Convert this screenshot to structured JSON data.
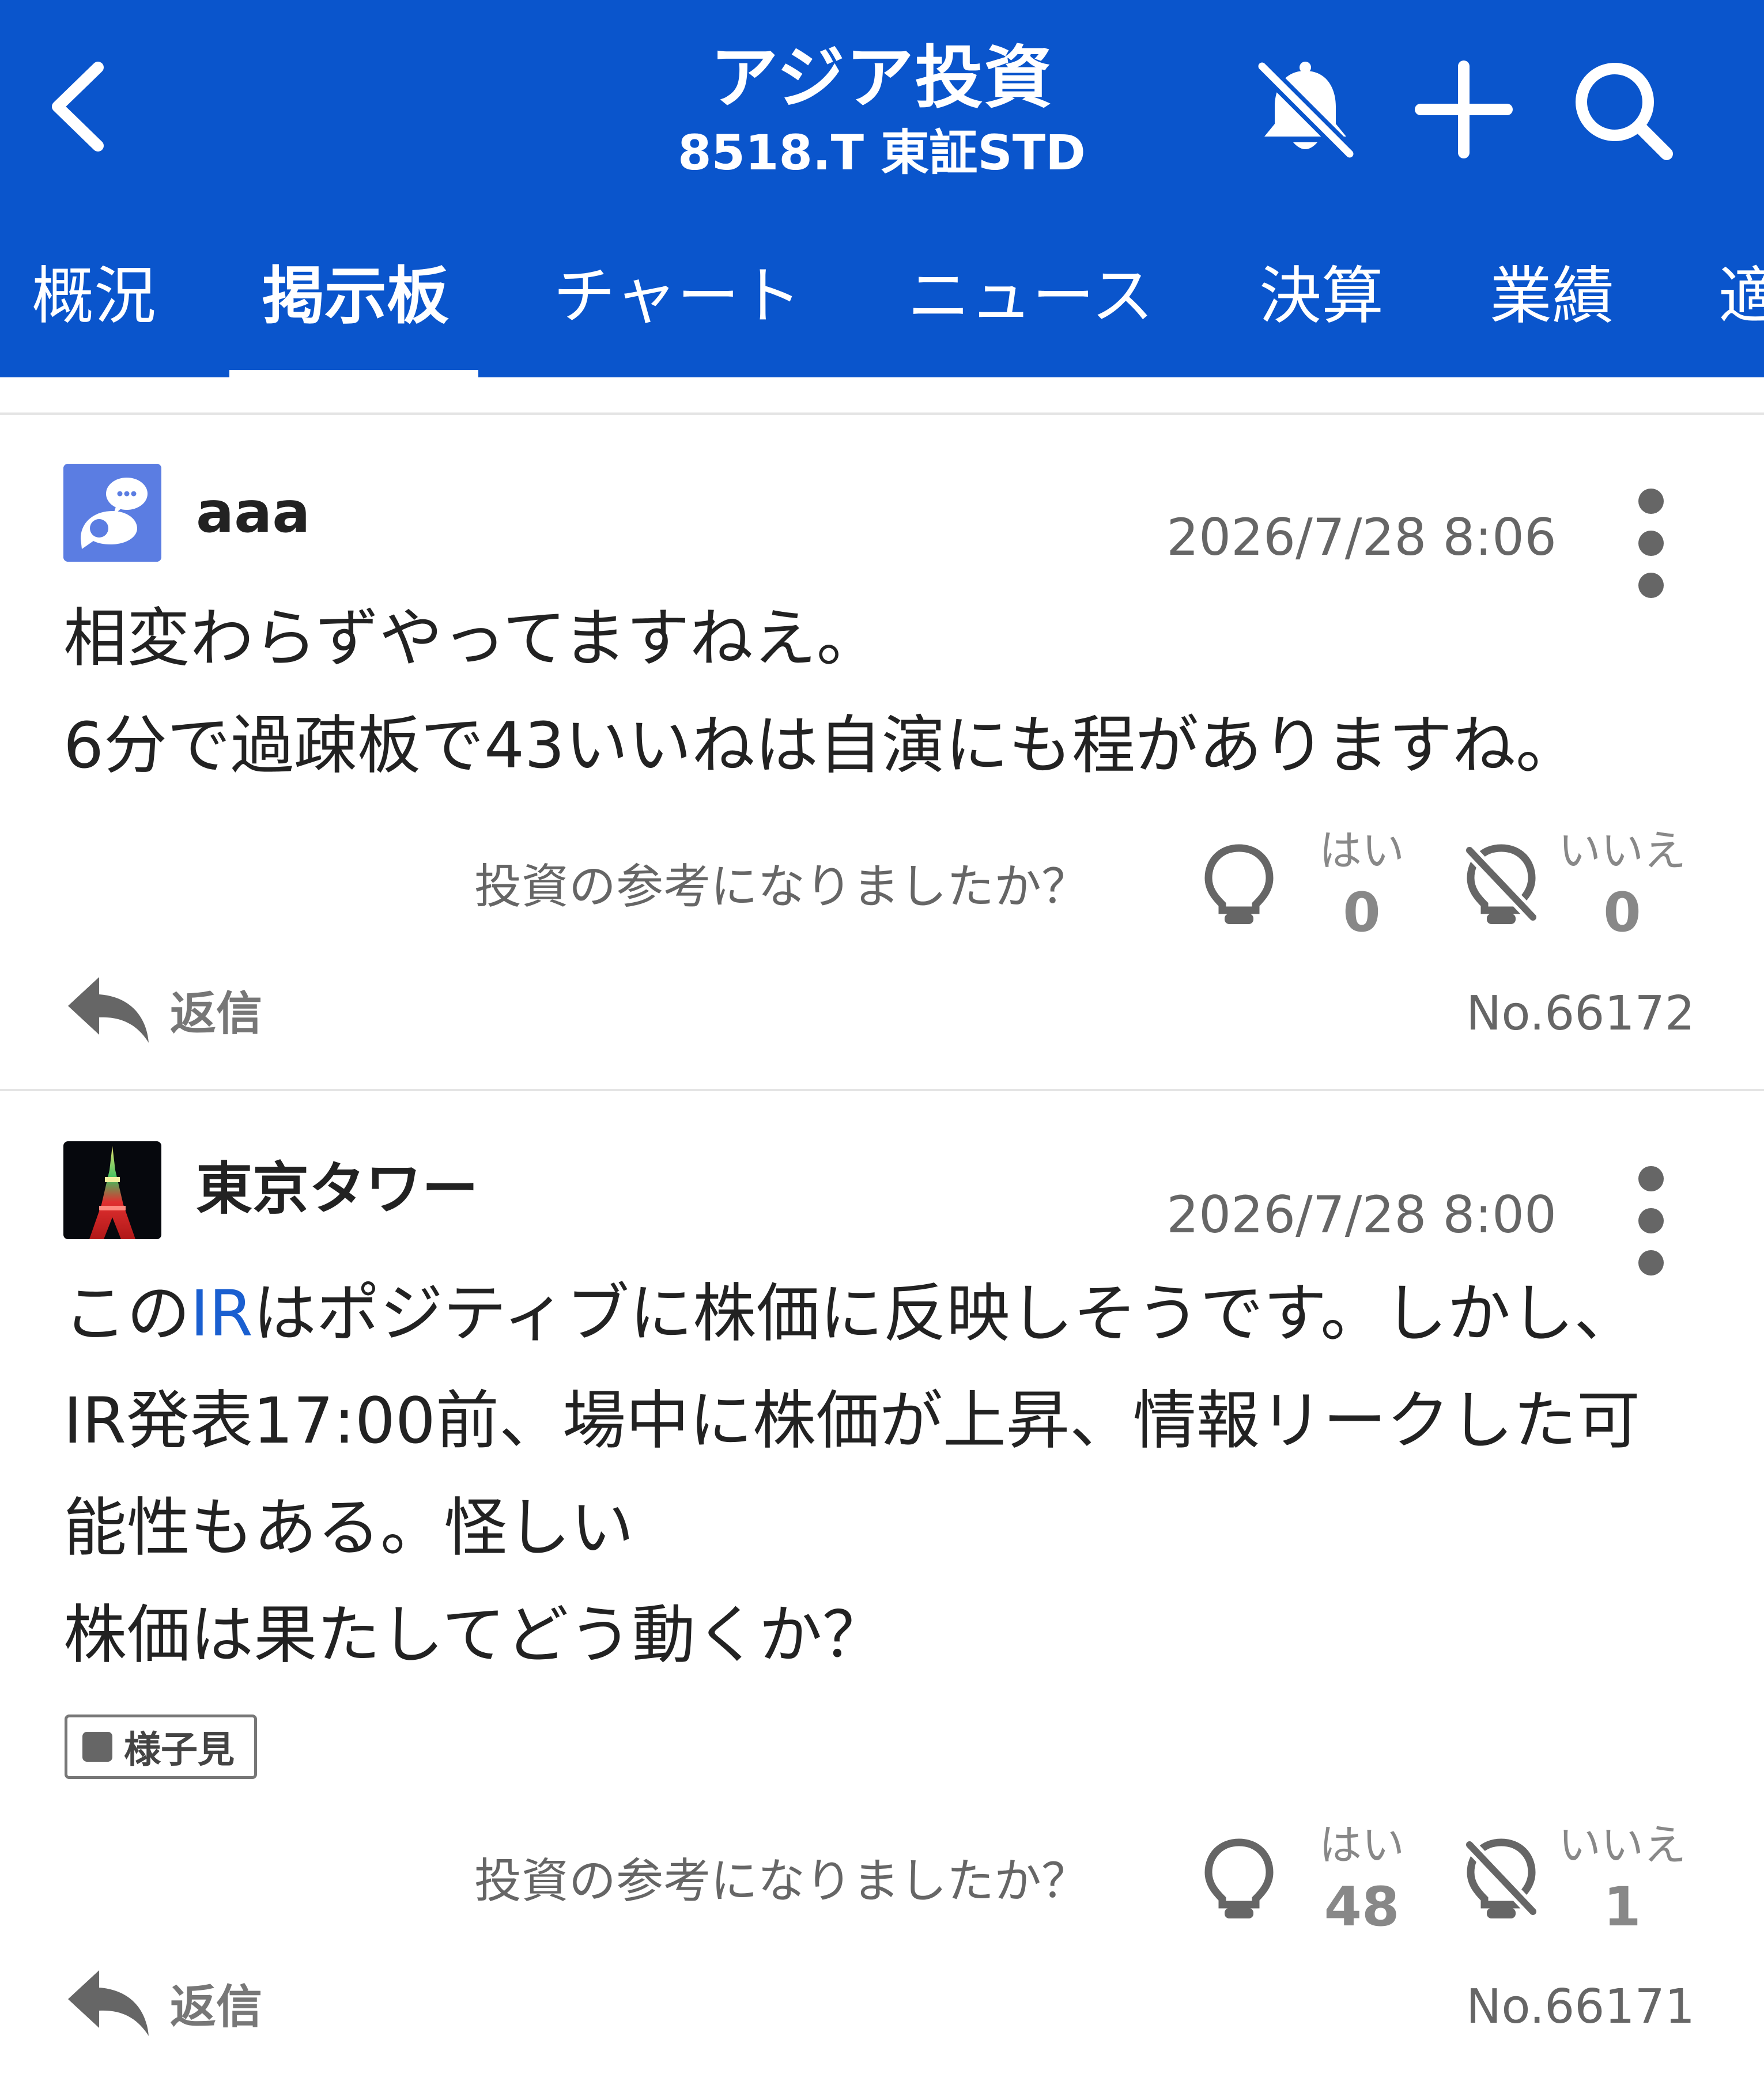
{
  "header": {
    "title": "アジア投資",
    "subtitle": "8518.T 東証STD",
    "icons": [
      "back-chevron-icon",
      "bell-off-icon",
      "plus-icon",
      "search-icon"
    ]
  },
  "tabs": [
    {
      "label": "概況"
    },
    {
      "label": "掲示板",
      "active": true
    },
    {
      "label": "チャート"
    },
    {
      "label": "ニュース"
    },
    {
      "label": "決算"
    },
    {
      "label": "業績"
    },
    {
      "label": "適"
    }
  ],
  "colors": {
    "header_bg": "#0a55cc",
    "link": "#1a5fd0",
    "muted": "#666666"
  },
  "posts": [
    {
      "username": "aaa",
      "timestamp": "2026/7/28 8:06",
      "lines": [
        "相変わらずやってますねえ。",
        "6分で過疎板で43いいねは自演にも程がありますね。"
      ],
      "question": "投資の参考になりましたか？",
      "yes_label": "はい",
      "yes_count": "0",
      "no_label": "いいえ",
      "no_count": "0",
      "reply_label": "返信",
      "post_no": "No.66172"
    },
    {
      "username": "東京タワー",
      "timestamp": "2026/7/28 8:00",
      "line1_pre": "この",
      "line1_link": "IR",
      "line1_post": "はポジティブに株価に反映しそうです。しかし、",
      "line2": "IR発表17:00前、場中に株価が上昇、情報リークした可",
      "line3": "能性もある。怪しい",
      "line4": "株価は果たしてどう動くか？",
      "tag": "様子見",
      "question": "投資の参考になりましたか？",
      "yes_label": "はい",
      "yes_count": "48",
      "no_label": "いいえ",
      "no_count": "1",
      "reply_label": "返信",
      "post_no": "No.66171"
    }
  ]
}
